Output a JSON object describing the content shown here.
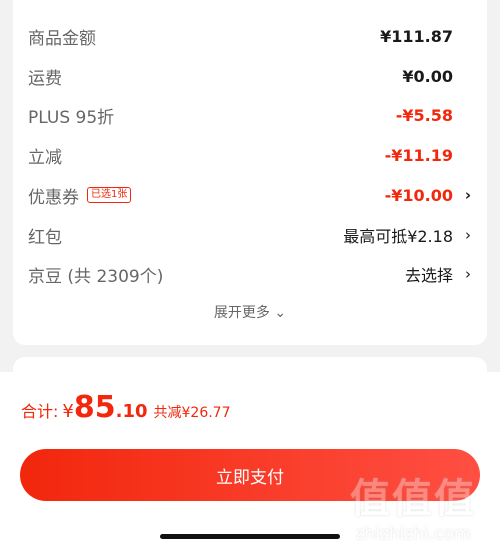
{
  "summary": {
    "rows": [
      {
        "label": "商品金额",
        "value": "¥111.87"
      },
      {
        "label": "运费",
        "value": "¥0.00"
      },
      {
        "label": "PLUS 95折",
        "value": "-¥5.58"
      },
      {
        "label": "立减",
        "value": "-¥11.19"
      },
      {
        "label": "优惠券",
        "tag": "已选1张",
        "value": "-¥10.00"
      },
      {
        "label": "红包",
        "value": "最高可抵¥2.18"
      },
      {
        "label": "京豆 (共 2309个)",
        "value": "去选择"
      }
    ],
    "expand_label": "展开更多",
    "expand_icon": "⌄"
  },
  "footer": {
    "total_label": "合计:",
    "currency": "¥",
    "total_int": "85",
    "total_dec": ".10",
    "saved_text": "共减¥26.77",
    "pay_label": "立即支付"
  },
  "icons": {
    "chevron": "›"
  },
  "watermark": {
    "logo": "值值值",
    "url": "zhizhizhi.com"
  },
  "colors": {
    "accent": "#f2270c",
    "text": "#1a1a1a",
    "muted": "#666666"
  }
}
